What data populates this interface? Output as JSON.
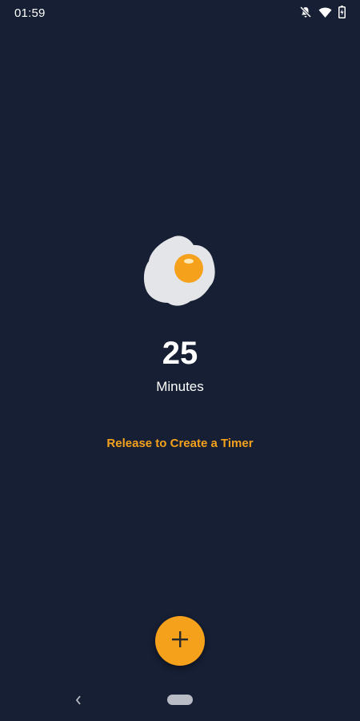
{
  "status_bar": {
    "time": "01:59",
    "icons": [
      "notifications-off-icon",
      "wifi-icon",
      "battery-icon"
    ]
  },
  "timer": {
    "illustration": "fried-egg-icon",
    "value": "25",
    "unit": "Minutes",
    "hint": "Release to Create a Timer"
  },
  "fab": {
    "icon": "plus-icon",
    "color": "#f5a11c"
  },
  "nav_bar": {
    "icons": [
      "back-icon",
      "home-pill-icon"
    ]
  },
  "colors": {
    "background": "#161f34",
    "accent": "#f5a11c",
    "text": "#ffffff"
  }
}
